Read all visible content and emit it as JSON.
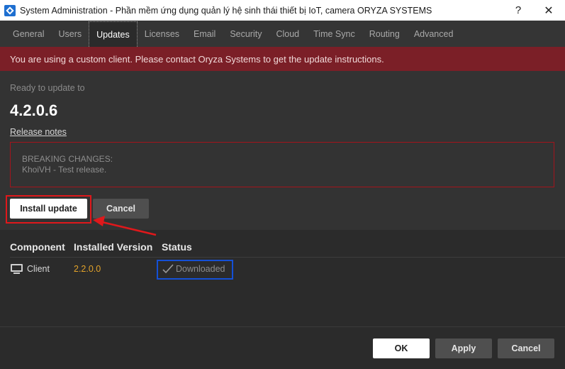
{
  "window": {
    "title": "System Administration - Phần mềm ứng dụng quản lý hệ sinh thái thiết bị IoT, camera ORYZA SYSTEMS",
    "help_label": "?",
    "close_label": "✕"
  },
  "tabs": [
    {
      "label": "General",
      "active": false
    },
    {
      "label": "Users",
      "active": false
    },
    {
      "label": "Updates",
      "active": true
    },
    {
      "label": "Licenses",
      "active": false
    },
    {
      "label": "Email",
      "active": false
    },
    {
      "label": "Security",
      "active": false
    },
    {
      "label": "Cloud",
      "active": false
    },
    {
      "label": "Time Sync",
      "active": false
    },
    {
      "label": "Routing",
      "active": false
    },
    {
      "label": "Advanced",
      "active": false
    }
  ],
  "banner": {
    "text": "You are using a custom client. Please contact Oryza Systems to get the update instructions.",
    "color": "#7b1f27"
  },
  "update": {
    "ready_label": "Ready to update to",
    "version": "4.2.0.6",
    "release_notes_link": "Release notes",
    "notes_line1": "BREAKING CHANGES:",
    "notes_line2": "KhoiVH - Test release.",
    "install_button": "Install update",
    "cancel_button": "Cancel"
  },
  "components": {
    "headers": {
      "component": "Component",
      "installed_version": "Installed Version",
      "status": "Status"
    },
    "rows": [
      {
        "icon": "monitor-icon",
        "component": "Client",
        "installed_version": "2.2.0.0",
        "status": "Downloaded"
      }
    ]
  },
  "footer": {
    "ok_button": "OK",
    "apply_button": "Apply",
    "cancel_button": "Cancel"
  },
  "colors": {
    "accent_highlight_red": "#e0181b",
    "accent_highlight_blue": "#1450d6",
    "version_text": "#e3a32a"
  }
}
